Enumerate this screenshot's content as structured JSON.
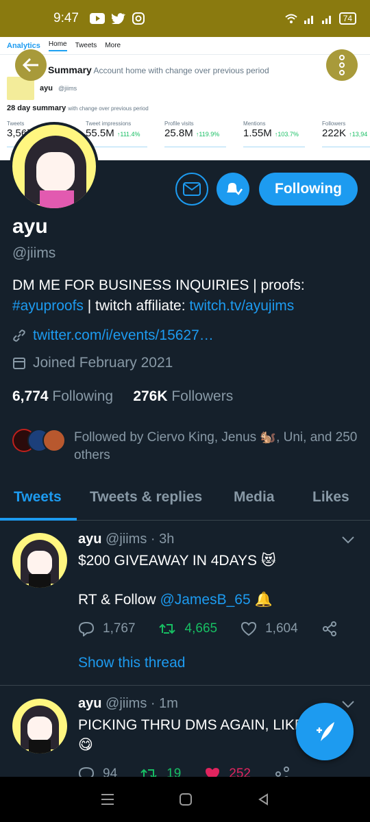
{
  "status_bar": {
    "time": "9:47",
    "battery": "74"
  },
  "banner": {
    "nav_logo": "Analytics",
    "nav_home": "Home",
    "nav_tweets": "Tweets",
    "nav_more": "More",
    "ghost_title": "Account home",
    "ghost_sub": "with change over previous period",
    "ghost_summary": "Summary",
    "acct_name": "ayu",
    "acct_handle": "@jiims",
    "summary_title": "28 day summary",
    "summary_sub": "with change over previous period",
    "stats": [
      {
        "label": "Tweets",
        "value": "3,567",
        "change": ""
      },
      {
        "label": "Tweet impressions",
        "value": "55.5M",
        "change": "↑111.4%"
      },
      {
        "label": "Profile visits",
        "value": "25.8M",
        "change": "↑119.9%"
      },
      {
        "label": "Mentions",
        "value": "1.55M",
        "change": "↑103.7%"
      },
      {
        "label": "Followers",
        "value": "222K",
        "change": "↑13,94"
      }
    ]
  },
  "profile": {
    "follow_label": "Following",
    "name": "ayu",
    "handle": "@jiims",
    "bio_1": "DM ME FOR BUSINESS INQUIRIES |  proofs: ",
    "bio_hashtag": "#ayuproofs",
    "bio_2": " | twitch affiliate: ",
    "bio_link": "twitch.tv/ayujims",
    "website": "twitter.com/i/events/15627…",
    "joined": "Joined February 2021",
    "following_count": "6,774",
    "following_label": "Following",
    "followers_count": "276K",
    "followers_label": "Followers",
    "followed_by": "Followed by Ciervo King, Jenus 🐿️, Uni, and 250 others"
  },
  "tabs": [
    "Tweets",
    "Tweets & replies",
    "Media",
    "Likes"
  ],
  "tweets": [
    {
      "name": "ayu",
      "meta": " @jiims · 3h",
      "line1": "$200 GIVEAWAY IN 4DAYS 😻",
      "line2_pre": "RT & Follow ",
      "line2_mention": "@JamesB_65",
      "line2_post": " 🔔",
      "replies": "1,767",
      "retweets": "4,665",
      "likes": "1,604",
      "show_thread": "Show this thread"
    },
    {
      "name": "ayu",
      "meta": " @jiims · 1m",
      "line1": "PICKING THRU DMS AGAIN, LIKE",
      "line2": "😋",
      "replies": "94",
      "retweets": "19",
      "likes": "252"
    }
  ],
  "colors": {
    "accent": "#1d9bf0",
    "background": "#15202b",
    "retweet": "#17bf63",
    "like": "#e0245e"
  }
}
